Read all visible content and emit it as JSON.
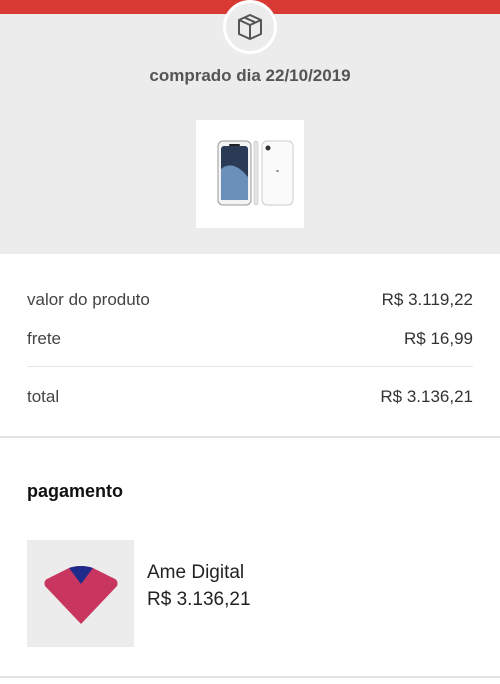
{
  "header": {
    "purchase_date": "comprado dia 22/10/2019",
    "badge_icon": "package-box-icon",
    "product_image": "iphone-xr-white-thumbnail"
  },
  "summary": {
    "product_label": "valor do produto",
    "product_value": "R$ 3.119,22",
    "shipping_label": "frete",
    "shipping_value": "R$ 16,99",
    "total_label": "total",
    "total_value": "R$ 3.136,21"
  },
  "payment": {
    "title": "pagamento",
    "method_name": "Ame Digital",
    "method_amount": "R$ 3.136,21",
    "method_icon": "ame-digital-logo-icon"
  },
  "colors": {
    "accent_red": "#d83a33",
    "header_bg": "#ececec",
    "ame_pink": "#c8365f",
    "ame_navy": "#1f2a8a"
  }
}
